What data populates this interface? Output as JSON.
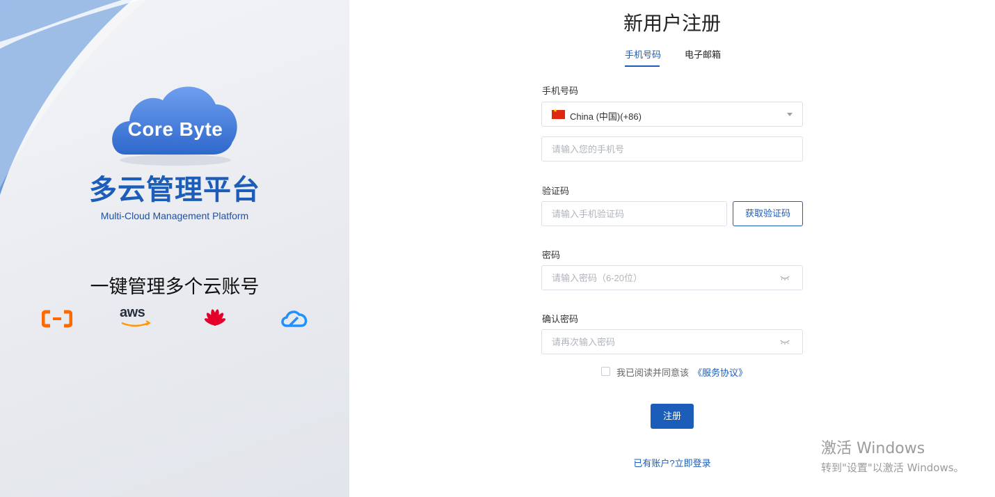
{
  "branding": {
    "cloud_logo_text": "Core Byte",
    "title": "多云管理平台",
    "subtitle": "Multi-Cloud Management Platform",
    "slogan": "一键管理多个云账号",
    "providers": [
      {
        "name": "aliyun",
        "icon": "alibaba-cloud-icon",
        "color": "#ff6a00"
      },
      {
        "name": "aws",
        "label": "aws",
        "icon": "aws-icon",
        "color": "#232f3e"
      },
      {
        "name": "huawei",
        "icon": "huawei-icon",
        "color": "#e4002b"
      },
      {
        "name": "tencent",
        "icon": "tencent-cloud-icon",
        "color": "#1e90ff"
      }
    ]
  },
  "form": {
    "title": "新用户注册",
    "tabs": [
      {
        "label": "手机号码",
        "active": true
      },
      {
        "label": "电子邮箱",
        "active": false
      }
    ],
    "phone_label": "手机号码",
    "country_select": {
      "value": "China (中国)(+86)",
      "flag": "china-flag-icon"
    },
    "phone_placeholder": "请输入您的手机号",
    "code_label": "验证码",
    "code_placeholder": "请输入手机验证码",
    "get_code_button": "获取验证码",
    "password_label": "密码",
    "password_placeholder": "请输入密码（6-20位）",
    "confirm_label": "确认密码",
    "confirm_placeholder": "请再次输入密码",
    "agree_text": "我已阅读并同意该",
    "agree_link": "《服务协议》",
    "agree_checked": false,
    "submit_button": "注册",
    "login_link": "已有账户?立即登录"
  },
  "watermark": {
    "line1": "激活 Windows",
    "line2": "转到\"设置\"以激活 Windows。"
  },
  "colors": {
    "primary": "#1b5db8",
    "left_bg": "#e8eaef"
  }
}
